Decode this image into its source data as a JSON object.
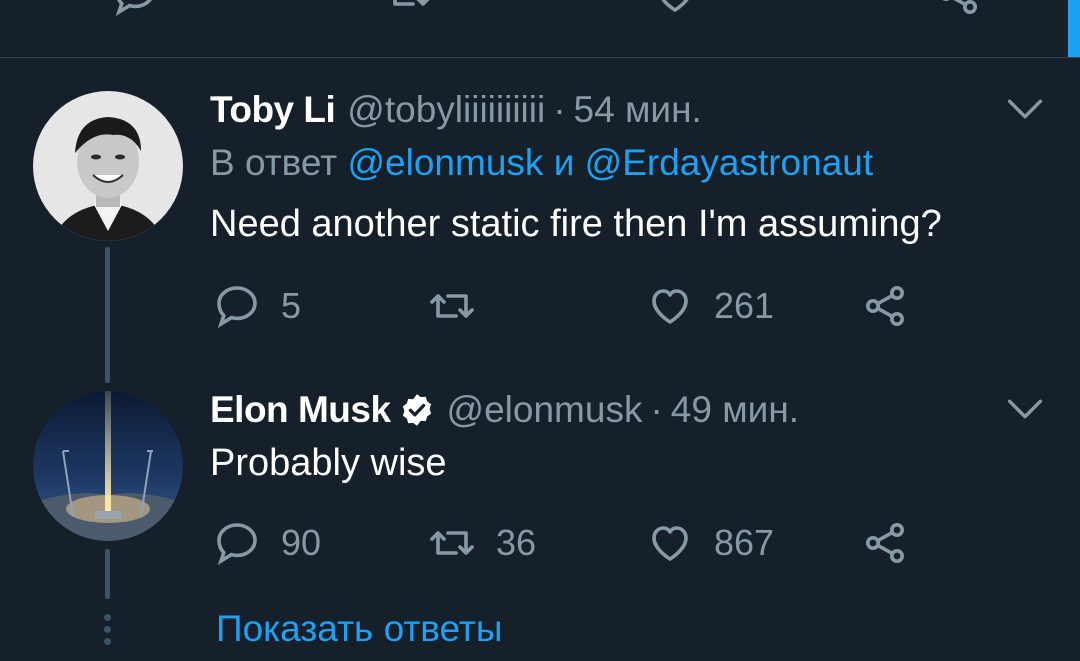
{
  "colors": {
    "background": "#15202b",
    "divider": "#38444d",
    "accent": "#1da1f2",
    "muted": "#8899a6",
    "text": "#ffffff"
  },
  "previous_tweet_actions": {
    "icons": [
      "reply-icon",
      "retweet-icon",
      "like-icon",
      "share-icon"
    ]
  },
  "tweets": [
    {
      "name": "Toby Li",
      "handle": "@tobyliiiiiiiiii",
      "separator": "·",
      "time": "54 мин.",
      "reply_prefix": "В ответ",
      "reply_mention_1": "@elonmusk",
      "reply_conjunction": "и",
      "reply_mention_2": "@Erdayastronaut",
      "text": "Need another static fire then I'm assuming?",
      "replies": "5",
      "retweets": "",
      "likes": "261",
      "avatar": "portrait-photo",
      "verified": false
    },
    {
      "name": "Elon Musk",
      "handle": "@elonmusk",
      "separator": "·",
      "time": "49 мин.",
      "text": "Probably wise",
      "replies": "90",
      "retweets": "36",
      "likes": "867",
      "avatar": "rocket-launch-photo",
      "verified": true
    }
  ],
  "show_replies": "Показать ответы"
}
